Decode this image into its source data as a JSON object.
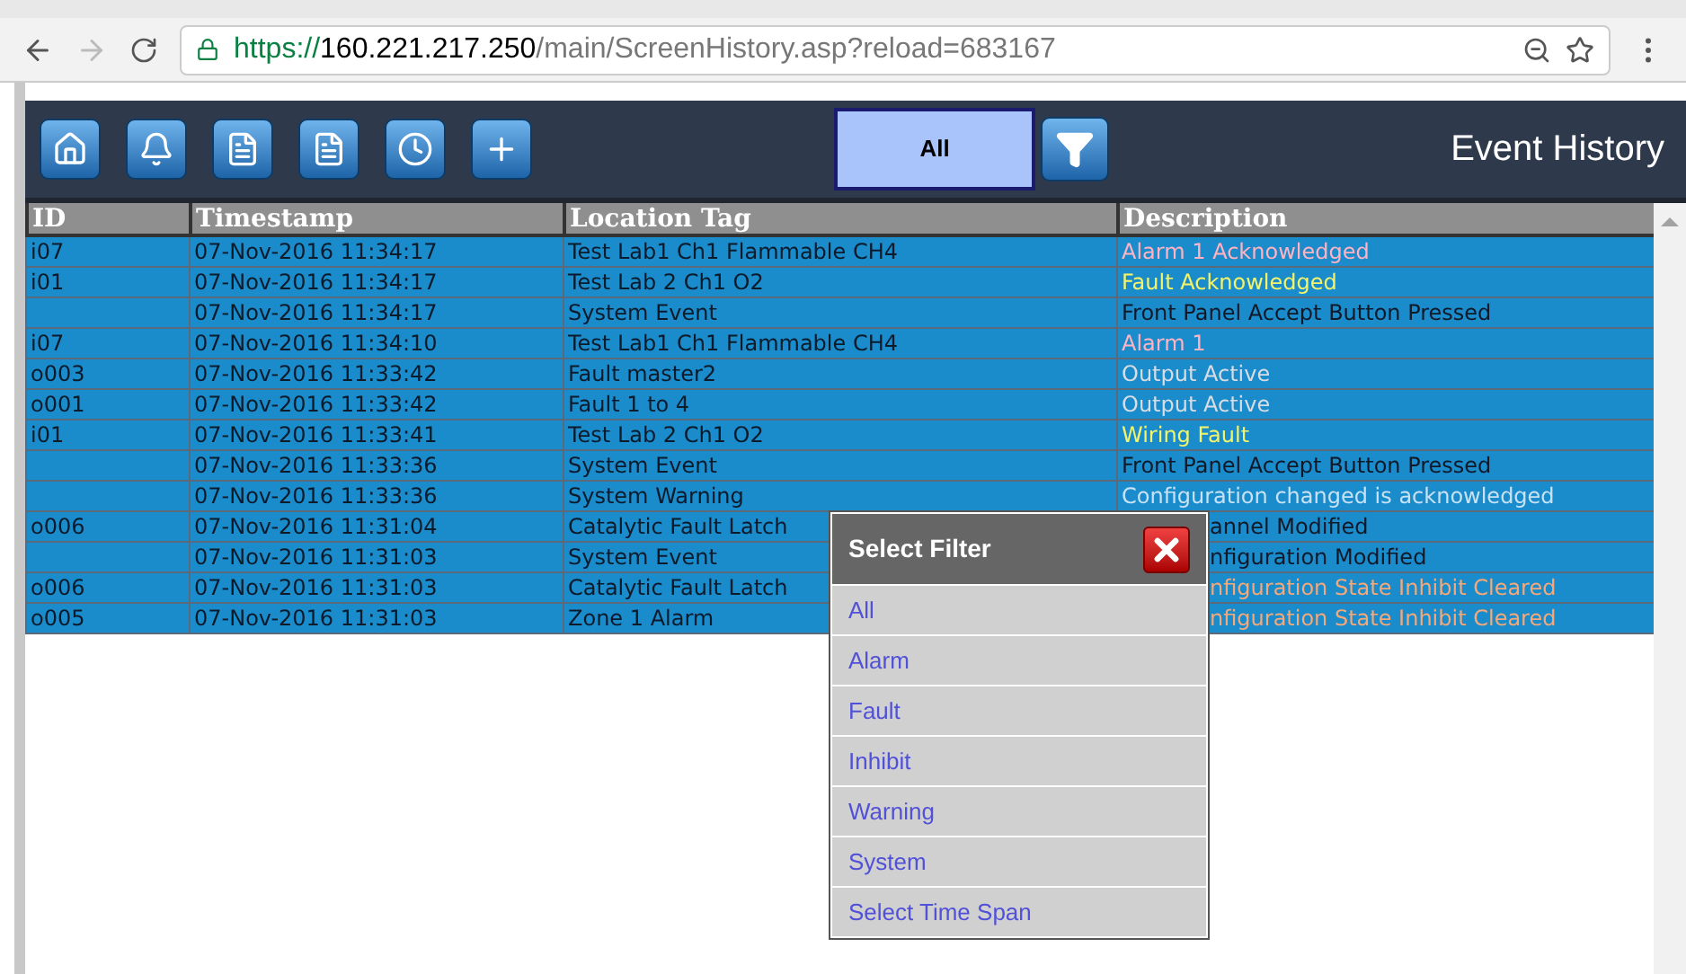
{
  "browser": {
    "url_secure": "https://",
    "url_host": "160.221.217.250",
    "url_path": "/main/ScreenHistory.asp?reload=683167"
  },
  "toolbar": {
    "filter_label": "All",
    "title": "Event History"
  },
  "table": {
    "columns": [
      "ID",
      "Timestamp",
      "Location Tag",
      "Description"
    ],
    "rows": [
      {
        "id": "i07",
        "timestamp": "07-Nov-2016 11:34:17",
        "location": "Test Lab1 Ch1 Flammable CH4",
        "description": "Alarm 1 Acknowledged",
        "color": "#ffb3c2",
        "kind": "full"
      },
      {
        "id": "i01",
        "timestamp": "07-Nov-2016 11:34:17",
        "location": "Test Lab 2 Ch1 O2",
        "description": "Fault Acknowledged",
        "color": "#f4f46a",
        "kind": "full"
      },
      {
        "id": "",
        "timestamp": "07-Nov-2016 11:34:17",
        "location": "System Event",
        "description": "Front Panel Accept Button Pressed",
        "color": "#111827",
        "kind": "full"
      },
      {
        "id": "i07",
        "timestamp": "07-Nov-2016 11:34:10",
        "location": "Test Lab1 Ch1 Flammable CH4",
        "description": "Alarm 1",
        "color": "#ffb3c2",
        "kind": "full"
      },
      {
        "id": "o003",
        "timestamp": "07-Nov-2016 11:33:42",
        "location": "Fault master2",
        "description": "Output Active",
        "color": "#d8dde3",
        "kind": "full"
      },
      {
        "id": "o001",
        "timestamp": "07-Nov-2016 11:33:42",
        "location": "Fault 1 to 4",
        "description": "Output Active",
        "color": "#d8dde3",
        "kind": "full"
      },
      {
        "id": "i01",
        "timestamp": "07-Nov-2016 11:33:41",
        "location": "Test Lab 2 Ch1 O2",
        "description": "Wiring Fault",
        "color": "#f4f46a",
        "kind": "full"
      },
      {
        "id": "",
        "timestamp": "07-Nov-2016 11:33:36",
        "location": "System Event",
        "description": "Front Panel Accept Button Pressed",
        "color": "#111827",
        "kind": "full"
      },
      {
        "id": "",
        "timestamp": "07-Nov-2016 11:33:36",
        "location": "System Warning",
        "description": "Configuration changed is acknowledged",
        "color": "#c6e2f4",
        "kind": "full"
      },
      {
        "id": "o006",
        "timestamp": "07-Nov-2016 11:31:04",
        "location": "Catalytic Fault Latch",
        "description": "annel Modified",
        "color": "#111827",
        "kind": "cut"
      },
      {
        "id": "",
        "timestamp": "07-Nov-2016 11:31:03",
        "location": "System Event",
        "description": "nfiguration Modified",
        "color": "#111827",
        "kind": "cut"
      },
      {
        "id": "o006",
        "timestamp": "07-Nov-2016 11:31:03",
        "location": "Catalytic Fault Latch",
        "description": "nfiguration State Inhibit Cleared",
        "color": "#f6a878",
        "kind": "cut"
      },
      {
        "id": "o005",
        "timestamp": "07-Nov-2016 11:31:03",
        "location": "Zone 1 Alarm",
        "description": "nfiguration State Inhibit Cleared",
        "color": "#f6a878",
        "kind": "cut"
      }
    ]
  },
  "filter_dialog": {
    "title": "Select Filter",
    "options": [
      "All",
      "Alarm",
      "Fault",
      "Inhibit",
      "Warning",
      "System",
      "Select Time Span"
    ]
  }
}
